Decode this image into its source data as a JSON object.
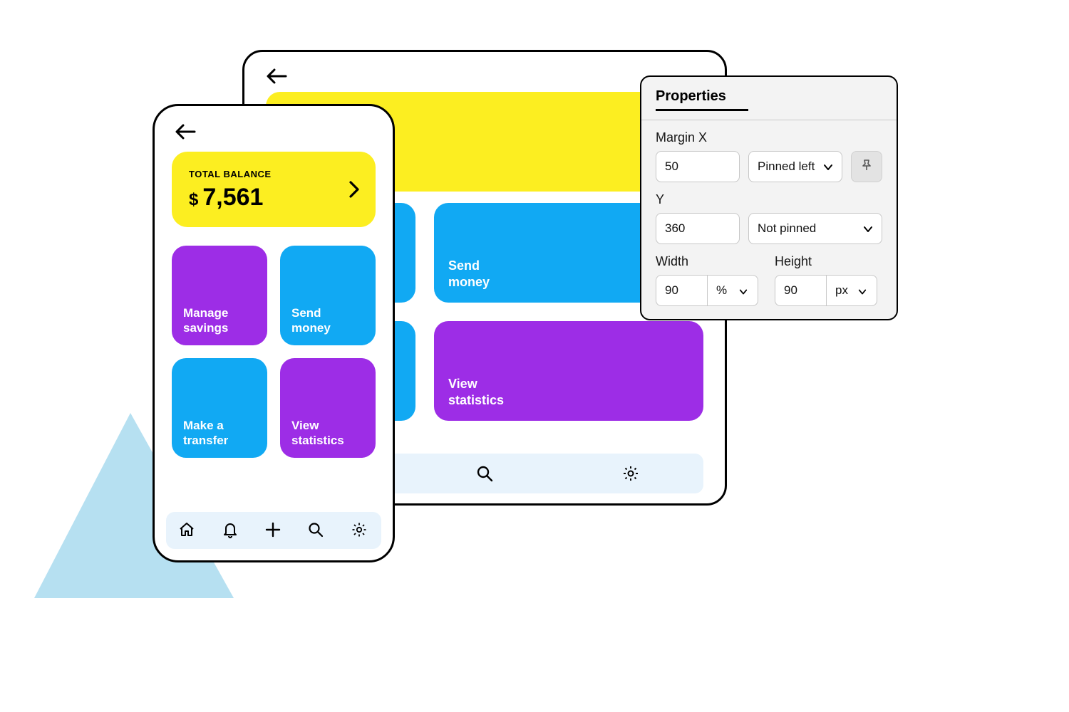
{
  "decor": {
    "triangle_color": "#a9dbef"
  },
  "tablet": {
    "tiles": [
      {
        "color": "blue",
        "label": ""
      },
      {
        "color": "blue",
        "label": "Send\nmoney"
      },
      {
        "color": "blue",
        "label": ""
      },
      {
        "color": "purple",
        "label": "View\nstatistics"
      }
    ]
  },
  "phone": {
    "balance": {
      "label": "TOTAL BALANCE",
      "currency": "$",
      "amount": "7,561"
    },
    "tiles": [
      {
        "color": "purple",
        "label": "Manage\nsavings"
      },
      {
        "color": "blue",
        "label": "Send\nmoney"
      },
      {
        "color": "blue",
        "label": "Make a\ntransfer"
      },
      {
        "color": "purple",
        "label": "View\nstatistics"
      }
    ]
  },
  "nav": {
    "icons": [
      "home-icon",
      "bell-icon",
      "plus-icon",
      "search-icon",
      "gear-icon"
    ]
  },
  "panel": {
    "title": "Properties",
    "fields": {
      "margin_x": {
        "label": "Margin X",
        "value": "50",
        "anchor": "Pinned left"
      },
      "y": {
        "label": "Y",
        "value": "360",
        "anchor": "Not pinned"
      },
      "width": {
        "label": "Width",
        "value": "90",
        "unit": "%"
      },
      "height": {
        "label": "Height",
        "value": "90",
        "unit": "px"
      }
    }
  }
}
